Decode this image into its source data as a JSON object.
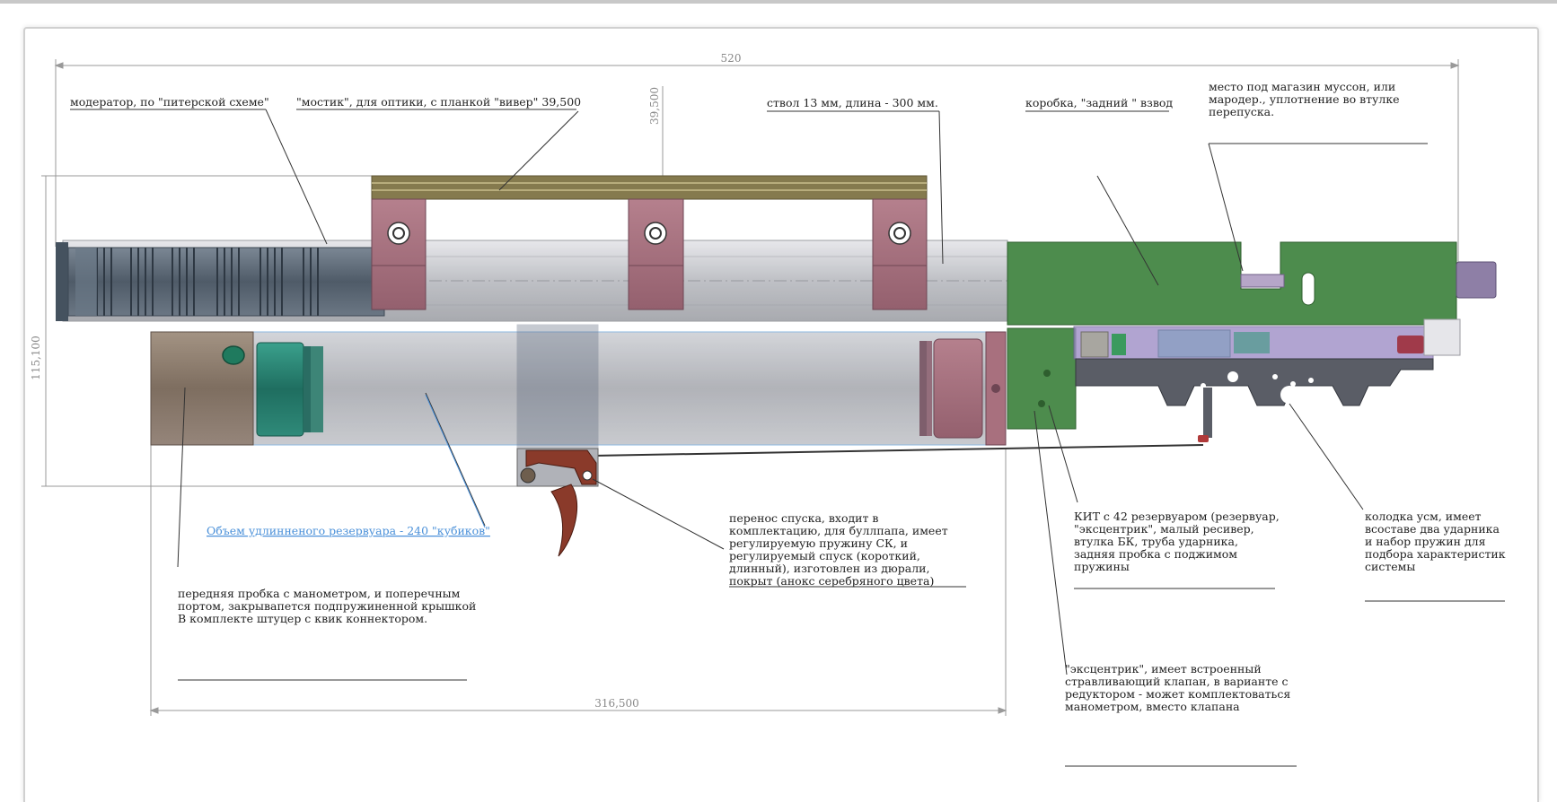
{
  "dimensions": {
    "overall_length": "520",
    "rail_height": "39,500",
    "overall_height": "115,100",
    "reservoir_length": "316,500"
  },
  "labels": {
    "moderator": "модератор, по \"питерской схеме\"",
    "bridge": "\"мостик\", для оптики, с планкой \"вивер\" 39,500",
    "barrel": "ствол 13 мм, длина - 300 мм.",
    "receiver": "коробка, \"задний \" взвод",
    "magazine": [
      "место под магазин муссон, или",
      "мародер., уплотнение во втулке",
      "перепуска."
    ],
    "reservoir_volume": "Объем удлинненого резервуара - 240 \"кубиков\"",
    "front_plug": [
      "передняя пробка с манометром, и поперечным",
      "портом, закрывапется подпружиненной крышкой",
      "В комплекте штуцер с квик коннектором."
    ],
    "trigger": [
      "перенос спуска, входит в",
      "комплектацию, для буллпапа, имеет",
      "регулируемую пружину СК, и",
      "регулируемый спуск (короткий,",
      "длинный), изготовлен из дюрали,",
      "покрыт (анокс серебряного цвета)"
    ],
    "kit": [
      "КИТ с 42 резервуаром (резервуар,",
      "\"эксцентрик\", малый ресивер,",
      "втулка БК, труба ударника,",
      "задняя пробка с поджимом",
      "пружины"
    ],
    "trigger_block": [
      "колодка усм, имеет",
      "всоставе два ударника",
      "и набор пружин для",
      "подбора характеристик",
      "системы"
    ],
    "eccentric": [
      "\"эксцентрик\", имеет встроенный",
      "стравливающий клапан, в варианте с",
      "редуктором - может комплектоваться",
      "манометром, вместо клапана"
    ]
  },
  "colors": {
    "rail": "#857a4e",
    "mount": "#a8707e",
    "receiver": "#4d8c4d",
    "moderator": "#5e6b78",
    "tank_cap": "#8b7b6c",
    "teal": "#2f8a79",
    "trigger_block": "#5a5d66",
    "trigger": "#8a3a2a"
  }
}
